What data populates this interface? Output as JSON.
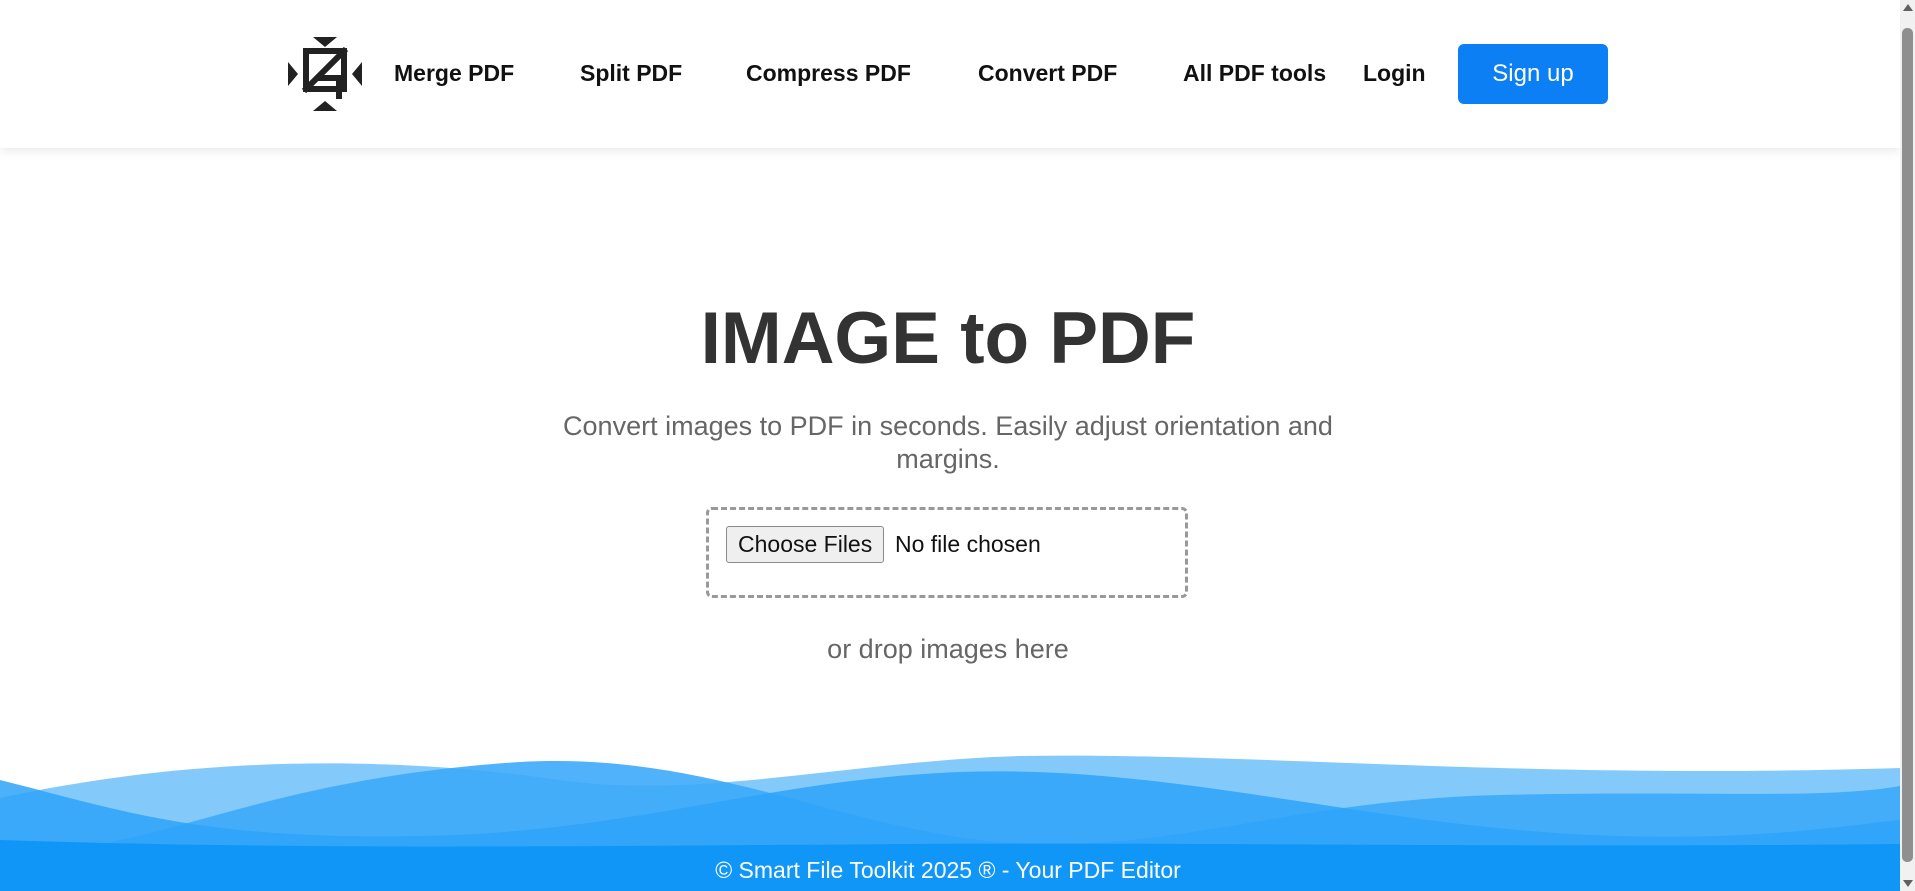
{
  "header": {
    "logo_icon": "smart-file-toolkit-logo",
    "nav": [
      {
        "label": "Merge PDF"
      },
      {
        "label": "Split PDF"
      },
      {
        "label": "Compress PDF"
      },
      {
        "label": "Convert PDF"
      },
      {
        "label": "All PDF tools"
      }
    ],
    "login_label": "Login",
    "signup_label": "Sign up"
  },
  "main": {
    "title": "IMAGE to PDF",
    "subtitle": "Convert images to PDF in seconds. Easily adjust orientation and margins.",
    "file_input": {
      "button_label": "Choose Files",
      "status": "No file chosen"
    },
    "drop_hint": "or drop images here"
  },
  "footer": {
    "text": "© Smart File Toolkit 2025 ® - Your PDF Editor"
  },
  "colors": {
    "accent": "#0d7ff5",
    "title": "#333333",
    "muted_text": "#666666",
    "wave_light": "#7cc7fb",
    "wave_mid": "#3daaf9",
    "wave_dark": "#1096f7"
  }
}
